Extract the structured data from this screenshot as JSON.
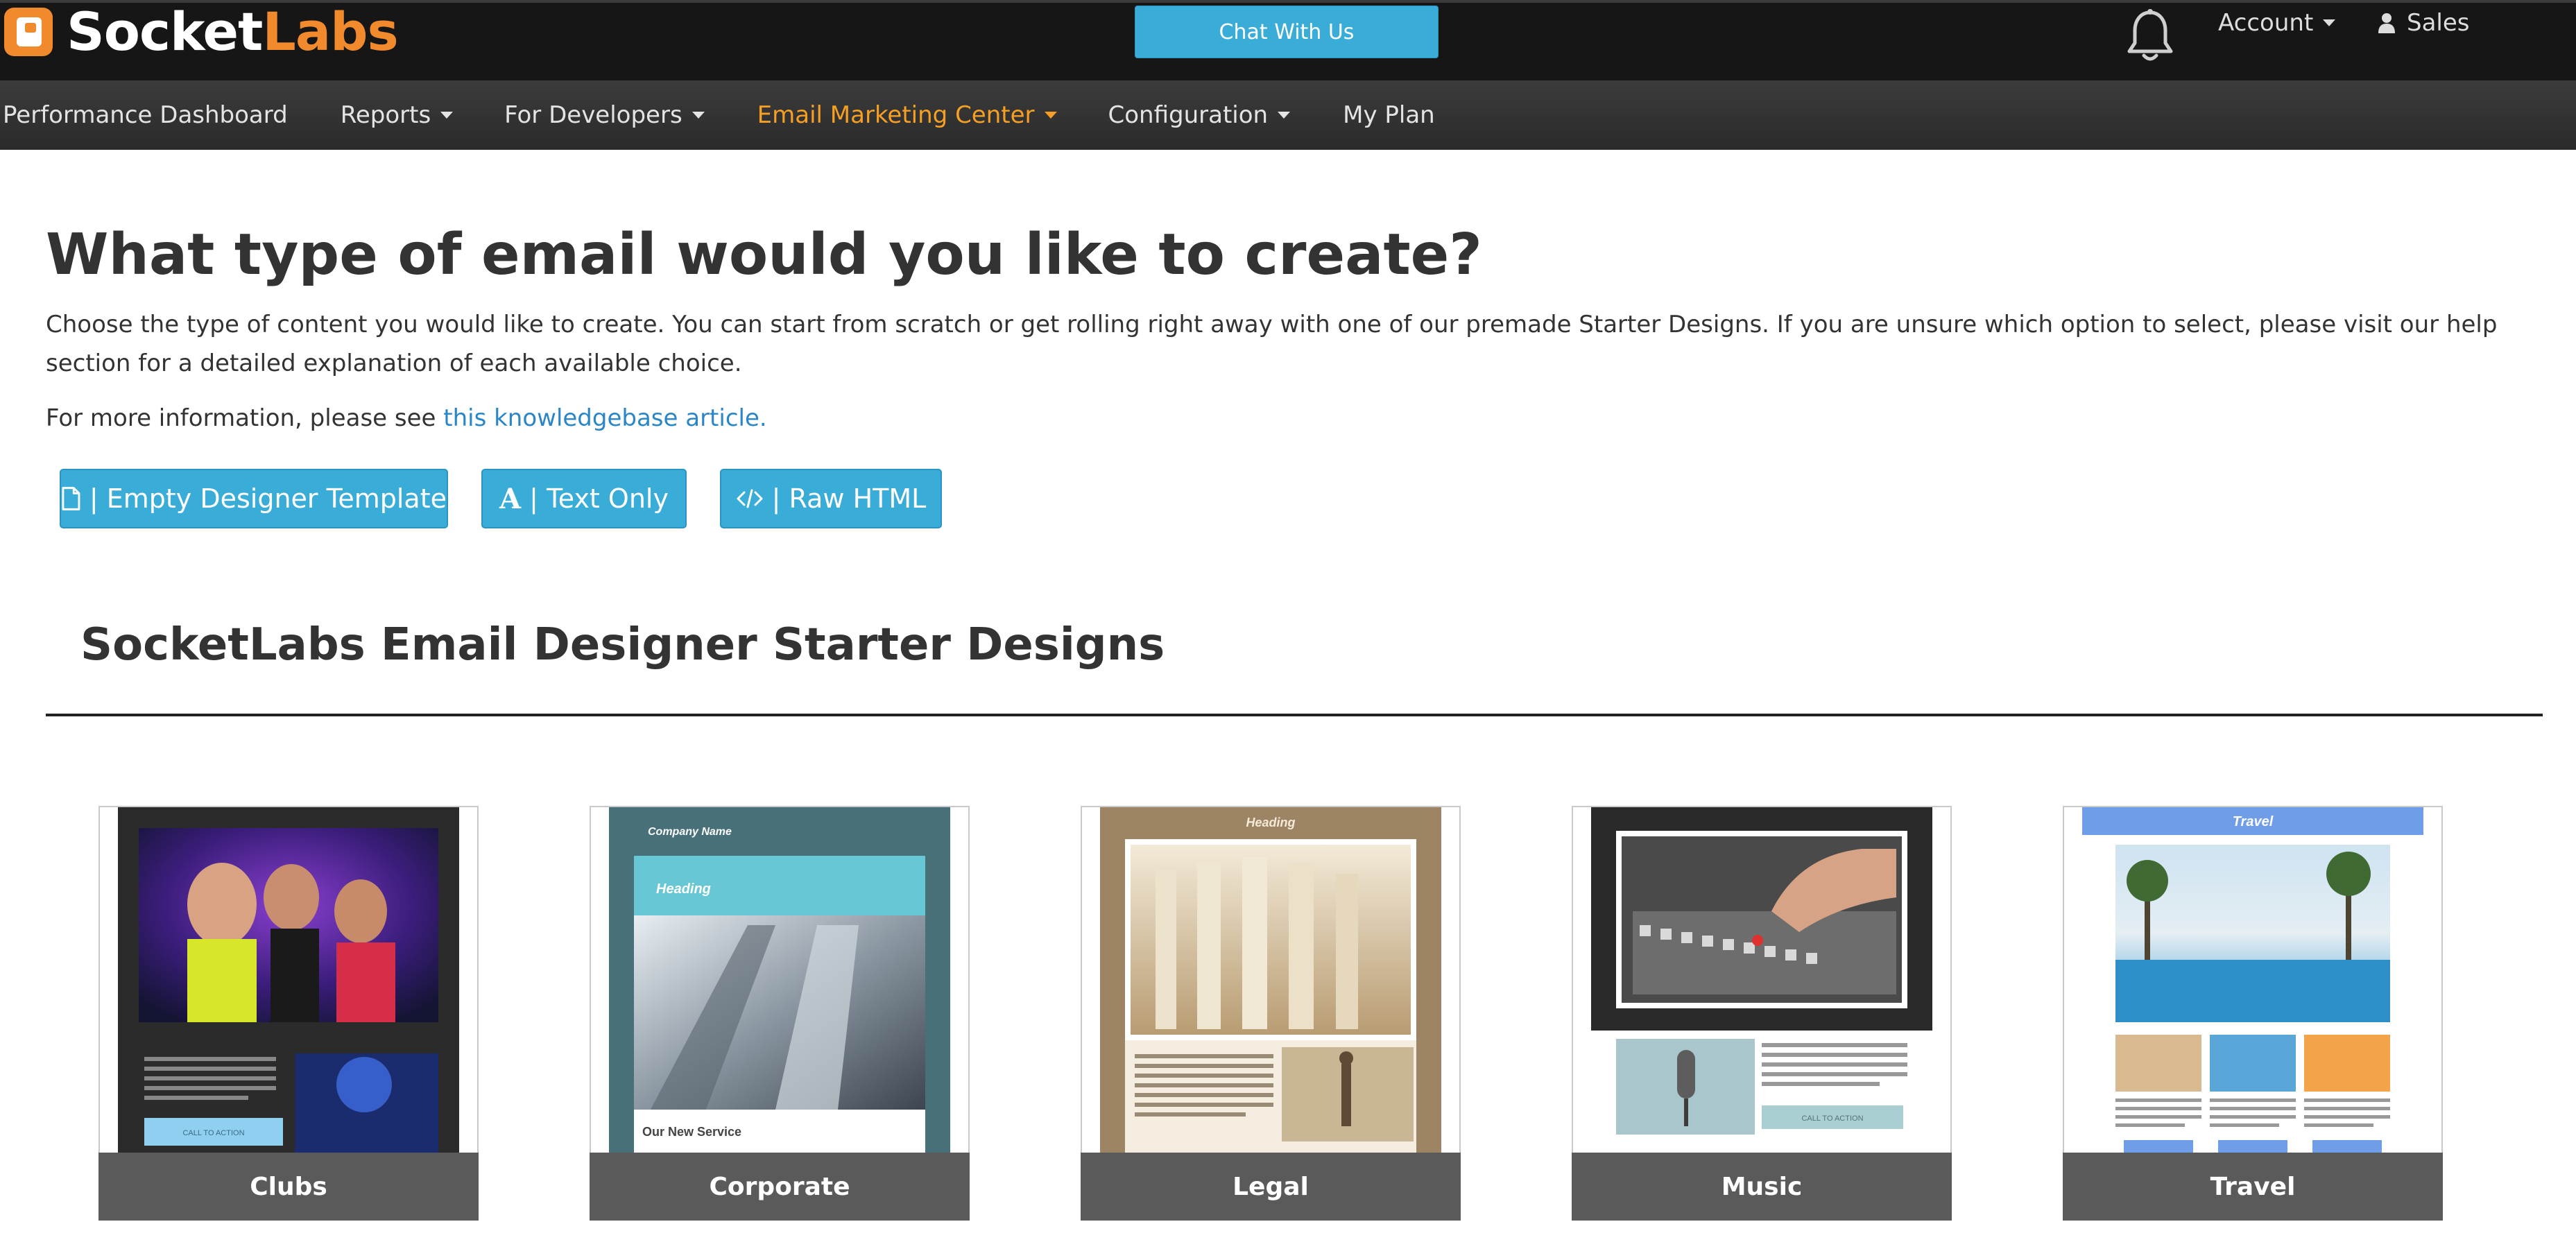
{
  "app": {
    "logo_text_a": "Socket",
    "logo_text_b": "Labs",
    "chat_label": "Chat With Us",
    "account_label": "Account",
    "user_label": "Sales"
  },
  "nav": {
    "items": [
      {
        "label": "Performance Dashboard",
        "has_caret": false,
        "active": false
      },
      {
        "label": "Reports",
        "has_caret": true,
        "active": false
      },
      {
        "label": "For Developers",
        "has_caret": true,
        "active": false
      },
      {
        "label": "Email Marketing Center",
        "has_caret": true,
        "active": true
      },
      {
        "label": "Configuration",
        "has_caret": true,
        "active": false
      },
      {
        "label": "My Plan",
        "has_caret": false,
        "active": false
      }
    ]
  },
  "page": {
    "title": "What type of email would you like to create?",
    "description": "Choose the type of content you would like to create. You can start from scratch or get rolling right away with one of our premade Starter Designs. If you are unsure which option to select, please visit our help section for a detailed explanation of each available choice.",
    "info_prefix": "For more information, please see ",
    "info_link": "this knowledgebase article."
  },
  "buttons": {
    "empty_template": "| Empty Designer Template",
    "text_only": "| Text Only",
    "raw_html": "| Raw HTML"
  },
  "starter": {
    "title": "SocketLabs Email Designer Starter Designs",
    "cards": [
      {
        "label": "Clubs"
      },
      {
        "label": "Corporate",
        "thumb_company": "Company Name",
        "thumb_heading": "Heading",
        "thumb_caption": "Our New Service"
      },
      {
        "label": "Legal",
        "thumb_heading": "Heading"
      },
      {
        "label": "Music",
        "thumb_cta": "CALL TO ACTION"
      },
      {
        "label": "Travel",
        "thumb_heading": "Travel"
      }
    ],
    "clubs_cta": "CALL TO ACTION"
  },
  "colors": {
    "brand_orange": "#f08a2c",
    "button_blue": "#3aacd8",
    "nav_active": "#f5a024",
    "link_blue": "#2a86c7"
  }
}
